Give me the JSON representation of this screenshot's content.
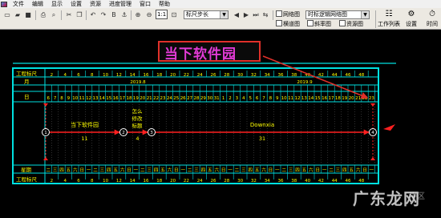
{
  "menu": [
    "文件",
    "编辑",
    "显示",
    "设置",
    "资源",
    "进度管理",
    "窗口",
    "帮助"
  ],
  "toolbar": {
    "zoom_label": "1:1",
    "scale_select": "标尺步长",
    "network_check_label": "网络图",
    "network_select": "时标逻辑网络图",
    "horizontal_label": "横道图",
    "slope_label": "斜率图",
    "resource_label": "资源图",
    "task_list_label": "工作列表",
    "settings_label": "设置",
    "time_label": "时间"
  },
  "annotation": {
    "text": "当下软件园"
  },
  "timeline": {
    "rows": {
      "ruler": "工程标尺",
      "month": "月",
      "day": "日",
      "week": "星期"
    },
    "month_labels": [
      "2019.8",
      "2019.9"
    ],
    "ruler_ticks": [
      "2",
      "4",
      "6",
      "8",
      "10",
      "12",
      "14",
      "16",
      "18",
      "20",
      "22",
      "24",
      "26",
      "28",
      "30",
      "32",
      "34",
      "36",
      "38",
      "40",
      "42",
      "44",
      "46",
      "48"
    ],
    "days": [
      "6",
      "7",
      "8",
      "9",
      "10",
      "11",
      "12",
      "13",
      "14",
      "15",
      "16",
      "17",
      "18",
      "19",
      "20",
      "21",
      "22",
      "23",
      "24",
      "25",
      "26",
      "27",
      "28",
      "29",
      "30",
      "31",
      "1",
      "2",
      "3",
      "4",
      "5",
      "6",
      "7",
      "8",
      "9",
      "10",
      "11",
      "12",
      "13",
      "14",
      "15",
      "16",
      "17",
      "18",
      "19",
      "20",
      "21",
      "22",
      "23"
    ],
    "weeks": [
      "二",
      "三",
      "四",
      "五",
      "六",
      "日",
      "一",
      "二",
      "三",
      "四",
      "五",
      "六",
      "日",
      "一",
      "二",
      "三",
      "四",
      "五",
      "六",
      "日",
      "一",
      "二",
      "三",
      "四",
      "五",
      "六",
      "日",
      "一",
      "二",
      "三",
      "四",
      "五",
      "六",
      "日",
      "一",
      "二",
      "三",
      "四",
      "五",
      "六",
      "日",
      "一",
      "二",
      "三",
      "四",
      "五",
      "六",
      "日",
      "一"
    ]
  },
  "network": {
    "nodes": [
      "1",
      "2",
      "3",
      "4"
    ],
    "tasks": [
      {
        "name": "当下软件园",
        "duration": "11"
      },
      {
        "name": "怎么修改标题",
        "duration": "4"
      },
      {
        "name": "Downxia",
        "duration": "31"
      }
    ]
  },
  "watermark": {
    "text": "广东龙网",
    "small": "牛区"
  },
  "colors": {
    "grid": "#00e0e0",
    "task": "#ff2020",
    "node": "#ffffff",
    "text": "#ffff00",
    "annotation": "#e23bd6"
  }
}
